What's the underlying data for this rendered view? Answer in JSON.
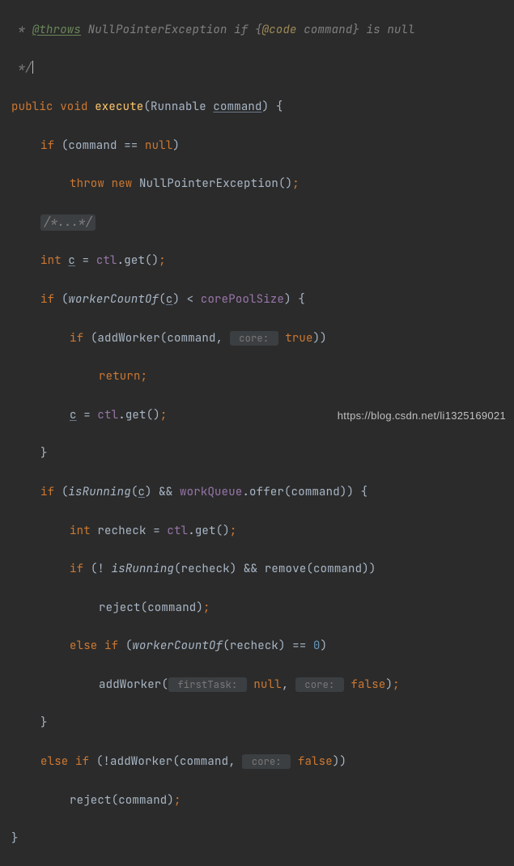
{
  "doc": {
    "star": " * ",
    "throws_tag": "@throws",
    "exception": " NullPointerException ",
    "if_word": "if ",
    "lbrace": "{",
    "code_tag": "@code",
    "code_body": " command} is null",
    "close": " */"
  },
  "sig": {
    "public": "public ",
    "void": "void ",
    "name": "execute",
    "lp": "(",
    "ptype": "Runnable ",
    "pname": "command",
    "rp": ") {"
  },
  "l1": {
    "if": "if ",
    "body": "(command == ",
    "null": "null",
    "close": ")"
  },
  "l2": {
    "throw": "throw ",
    "new": "new ",
    "body": "NullPointerException()",
    "semi": ";"
  },
  "fold": "/*...*/",
  "l3": {
    "int": "int ",
    "var": "c",
    "eq": " = ",
    "ctl": "ctl",
    "call": ".get()",
    "semi": ";"
  },
  "l4": {
    "if": "if ",
    "lp": "(",
    "fn": "workerCountOf",
    "arg": "(",
    "c": "c",
    "rp": ") < ",
    "core": "corePoolSize",
    "end": ") {"
  },
  "l5": {
    "if": "if ",
    "body": "(addWorker(command, ",
    "hint": " core: ",
    "true": "true",
    "end": "))"
  },
  "l6": {
    "return": "return",
    "semi": ";"
  },
  "l7": {
    "c": "c",
    "eq": " = ",
    "ctl": "ctl",
    "call": ".get()",
    "semi": ";"
  },
  "l8": "}",
  "l9": {
    "if": "if ",
    "lp": "(",
    "fn": "isRunning",
    "ao": "(",
    "c": "c",
    "ac": ") && ",
    "wq": "workQueue",
    "call": ".offer(command)) {"
  },
  "l10": {
    "int": "int ",
    "body": "recheck = ",
    "ctl": "ctl",
    "call": ".get()",
    "semi": ";"
  },
  "l11": {
    "if": "if ",
    "body1": "(! ",
    "fn": "isRunning",
    "body2": "(recheck) && remove(command))"
  },
  "l12": {
    "body": "reject(command)",
    "semi": ";"
  },
  "l13": {
    "else": "else if ",
    "lp": "(",
    "fn": "workerCountOf",
    "body": "(recheck) == ",
    "zero": "0",
    "rp": ")"
  },
  "l14": {
    "body1": "addWorker(",
    "hint1": " firstTask: ",
    "null": "null",
    "comma": ", ",
    "hint2": " core: ",
    "false": "false",
    "rp": ")",
    "semi": ";"
  },
  "l15": "}",
  "l16": {
    "else": "else if ",
    "body": "(!addWorker(command, ",
    "hint": " core: ",
    "false": "false",
    "end": "))"
  },
  "l17": {
    "body": "reject(command)",
    "semi": ";"
  },
  "l18": "}",
  "watermark": "https://blog.csdn.net/li1325169021"
}
